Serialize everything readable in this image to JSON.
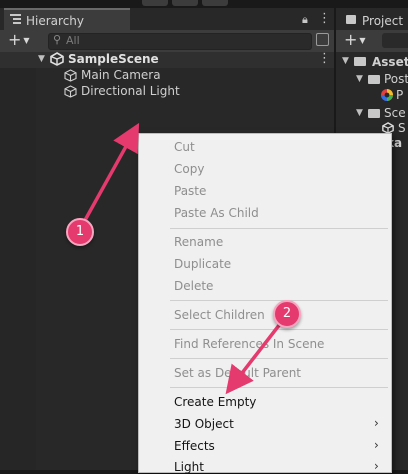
{
  "hierarchy": {
    "tab_label": "Hierarchy",
    "search_placeholder": "All",
    "scene_name": "SampleScene",
    "objects": [
      "Main Camera",
      "Directional Light"
    ]
  },
  "project": {
    "tab_label": "Project",
    "tree": [
      "Asset",
      "Post",
      "P",
      "Sce",
      "S",
      "ka"
    ]
  },
  "context_menu": {
    "items": [
      {
        "label": "Cut",
        "enabled": false
      },
      {
        "label": "Copy",
        "enabled": false
      },
      {
        "label": "Paste",
        "enabled": false
      },
      {
        "label": "Paste As Child",
        "enabled": false
      },
      {
        "label": "Rename",
        "enabled": false
      },
      {
        "label": "Duplicate",
        "enabled": false
      },
      {
        "label": "Delete",
        "enabled": false
      },
      {
        "label": "Select Children",
        "enabled": false
      },
      {
        "label": "Find References In Scene",
        "enabled": false
      },
      {
        "label": "Set as Default Parent",
        "enabled": false
      },
      {
        "label": "Create Empty",
        "enabled": true
      },
      {
        "label": "3D Object",
        "enabled": true
      },
      {
        "label": "Effects",
        "enabled": true
      },
      {
        "label": "Light",
        "enabled": true
      }
    ]
  },
  "annotations": {
    "badge1": "1",
    "badge2": "2",
    "color": "#e43a6e"
  }
}
